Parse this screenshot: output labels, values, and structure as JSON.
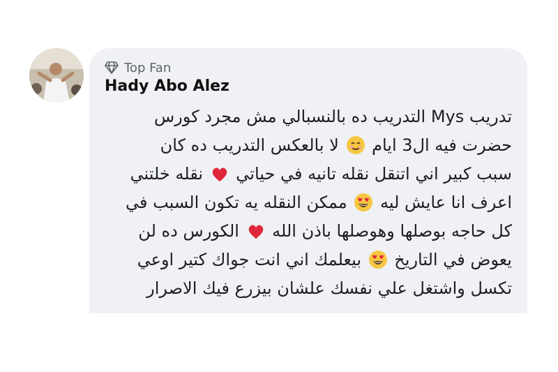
{
  "comment": {
    "badge": {
      "icon": "diamond-icon",
      "label": "Top Fan"
    },
    "author": "Hady Abo Alez",
    "avatar": "profile-photo",
    "lines": [
      [
        {
          "t": "text",
          "v": "تدريب Mys التدريب ده بالنسبالي مش مجرد كورس"
        }
      ],
      [
        {
          "t": "text",
          "v": "حضرت فيه ال3 ايام"
        },
        {
          "t": "emoji",
          "v": "smile"
        },
        {
          "t": "text",
          "v": "لا بالعكس التدريب ده كان"
        }
      ],
      [
        {
          "t": "text",
          "v": "سبب كبير اني اتنقل نقله تانيه في حياتي"
        },
        {
          "t": "emoji",
          "v": "heart"
        },
        {
          "t": "text",
          "v": "نقله خلتني"
        }
      ],
      [
        {
          "t": "text",
          "v": "اعرف انا عايش ليه"
        },
        {
          "t": "emoji",
          "v": "hearteyes"
        },
        {
          "t": "text",
          "v": "ممكن  النقله يه تكون السبب في"
        }
      ],
      [
        {
          "t": "text",
          "v": "كل حاجه بوصلها وهوصلها باذن الله"
        },
        {
          "t": "emoji",
          "v": "heart"
        },
        {
          "t": "text",
          "v": "الكورس ده لن"
        }
      ],
      [
        {
          "t": "text",
          "v": "يعوض في التاريخ"
        },
        {
          "t": "emoji",
          "v": "hearteyes"
        },
        {
          "t": "text",
          "v": "بيعلمك اني انت جواك كتير اوعي"
        }
      ],
      [
        {
          "t": "text",
          "v": "تكسل واشتغل علي نفسك علشان بيزرع فيك الاصرار"
        }
      ]
    ]
  },
  "colors": {
    "bubble": "#eff1f4",
    "name": "#111111",
    "text": "#1c1e21",
    "badge": "#5f6368",
    "heart": "#e0263a",
    "emoji_face": "#f7c744"
  }
}
